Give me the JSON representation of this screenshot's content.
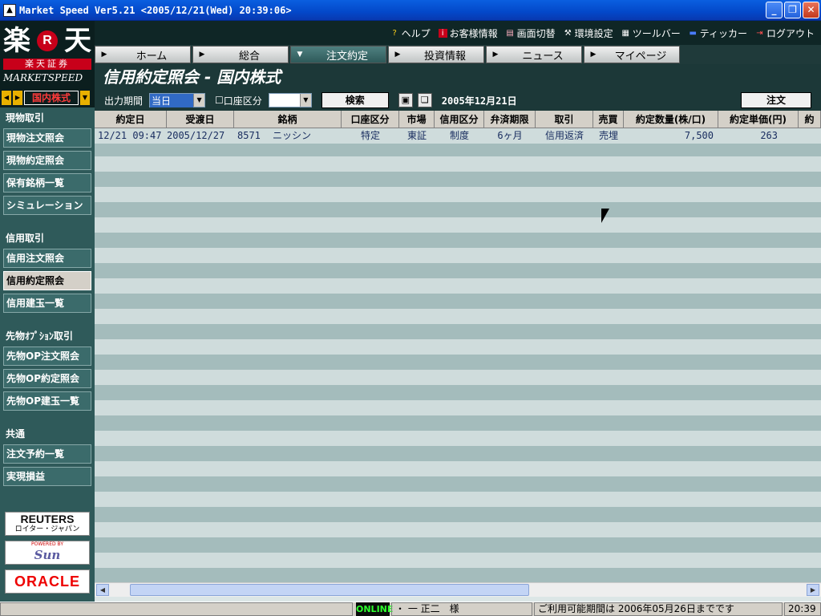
{
  "window": {
    "title": "Market Speed Ver5.21 <2005/12/21(Wed) 20:39:06>",
    "app_icon": "chart-icon"
  },
  "logo": {
    "big": "楽",
    "big2": "天",
    "r": "R",
    "sub": "楽天証券",
    "ms": "MARKETSPEED"
  },
  "topmenu": [
    {
      "icon": "?",
      "label": "ヘルプ"
    },
    {
      "icon": "i",
      "label": "お客様情報"
    },
    {
      "icon": "▤",
      "label": "画面切替"
    },
    {
      "icon": "⚒",
      "label": "環境設定"
    },
    {
      "icon": "▦",
      "label": "ツールバー"
    },
    {
      "icon": "▬",
      "label": "ティッカー"
    },
    {
      "icon": "⇥",
      "label": "ログアウト"
    }
  ],
  "tabs": [
    {
      "label": "ホーム",
      "arrow": "▶"
    },
    {
      "label": "総合",
      "arrow": "▶"
    },
    {
      "label": "注文約定",
      "arrow": "▼"
    },
    {
      "label": "投資情報",
      "arrow": "▶"
    },
    {
      "label": "ニュース",
      "arrow": "▶"
    },
    {
      "label": "マイページ",
      "arrow": "▶"
    }
  ],
  "market_select": {
    "value": "国内株式"
  },
  "nav": {
    "sec1": "現物取引",
    "btn1": "現物注文照会",
    "btn2": "現物約定照会",
    "btn3": "保有銘柄一覧",
    "btn4": "シミュレーション",
    "sec2": "信用取引",
    "btn5": "信用注文照会",
    "btn6": "信用約定照会",
    "btn7": "信用建玉一覧",
    "sec3": "先物ｵﾌﾟｼｮﾝ取引",
    "btn8": "先物OP注文照会",
    "btn9": "先物OP約定照会",
    "btn10": "先物OP建玉一覧",
    "sec4": "共通",
    "btn11": "注文予約一覧",
    "btn12": "実現損益"
  },
  "sponsors": {
    "reuters": "REUTERS",
    "reuters_sub": "ロイター・ジャパン",
    "sun_top": "POWERED BY",
    "sun": "Sun",
    "oracle": "ORACLE"
  },
  "page": {
    "title": "信用約定照会 - 国内株式"
  },
  "toolbar": {
    "period_label": "出力期間",
    "period_value": "当日",
    "account_label": "口座区分",
    "account_value": "",
    "search_label": "検索",
    "date": "2005年12月21日",
    "order_label": "注文"
  },
  "table": {
    "headers": [
      "約定日",
      "受渡日",
      "銘柄",
      "口座区分",
      "市場",
      "信用区分",
      "弁済期限",
      "取引",
      "売買",
      "約定数量(株/口)",
      "約定単価(円)",
      "約"
    ],
    "rows": [
      {
        "c0": "12/21 09:47",
        "c1": "2005/12/27",
        "c2": "8571",
        "c2b": "ニッシン",
        "c3": "特定",
        "c4": "東証",
        "c5": "制度",
        "c6": "6ヶ月",
        "c7": "信用返済",
        "c8": "売埋",
        "c9": "7,500",
        "c10": "263"
      }
    ]
  },
  "status": {
    "online": "ONLINE",
    "user": "・ 一 正二　様",
    "period": "ご利用可能期間は 2006年05月26日までです",
    "time": "20:39"
  }
}
